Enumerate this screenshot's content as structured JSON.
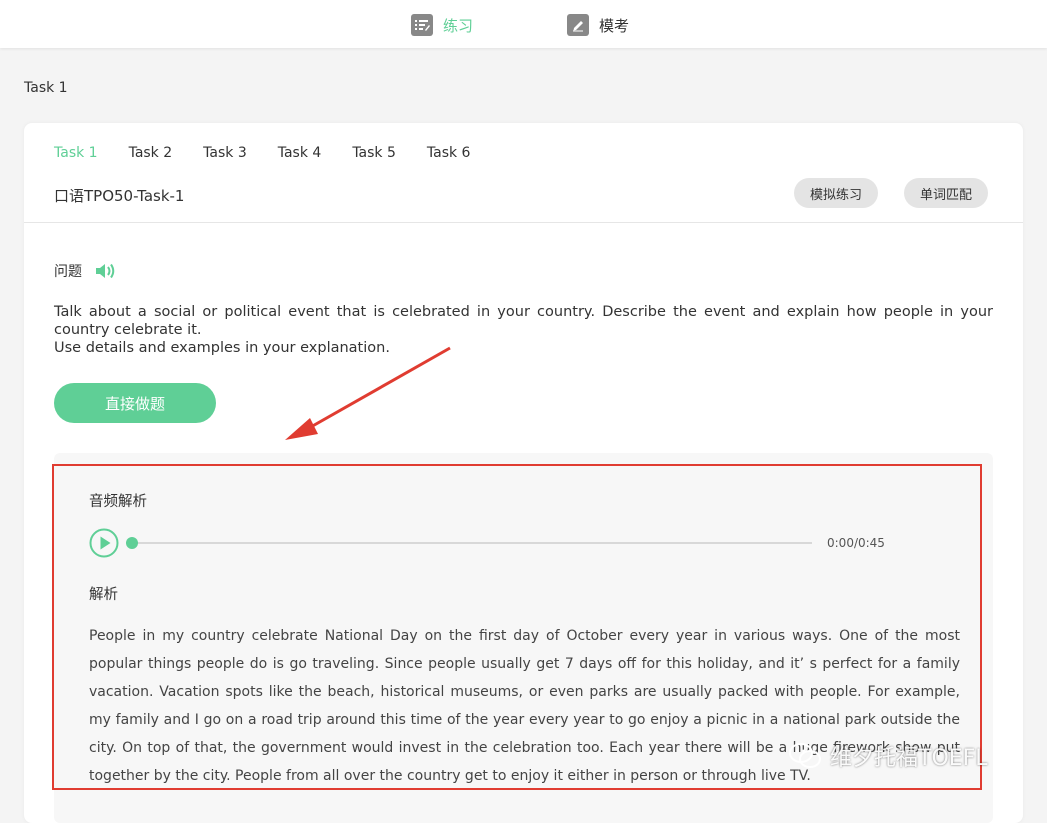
{
  "nav": {
    "practice_label": "练习",
    "exam_label": "模考"
  },
  "breadcrumb": "Task 1",
  "tabs": [
    {
      "label": "Task 1",
      "active": true
    },
    {
      "label": "Task 2"
    },
    {
      "label": "Task 3"
    },
    {
      "label": "Task 4"
    },
    {
      "label": "Task 5"
    },
    {
      "label": "Task 6"
    }
  ],
  "task_title": "口语TPO50-Task-1",
  "buttons": {
    "simulate": "模拟练习",
    "word_match": "单词匹配",
    "start": "直接做题"
  },
  "question": {
    "label": "问题",
    "line1": "Talk about a social or political event that is celebrated in your country. Describe the event and explain how people in your country celebrate it.",
    "line2": "Use details and examples in your explanation."
  },
  "audio": {
    "title": "音频解析",
    "time": "0:00/0:45",
    "progress": 0
  },
  "explanation": {
    "title": "解析",
    "text": "People in my country celebrate National Day on the first day of October every year in various ways. One of the most popular things people do is go traveling. Since people usually get 7 days off for this holiday, and it’ s perfect for a family vacation. Vacation spots like the beach, historical museums, or even parks are usually packed with people. For example, my family and I go on a road trip around this time of the year every year to go enjoy a picnic in a national park outside the city. On top of that, the government would invest in the celebration too. Each year there will be a huge firework show put together by the city. People from all over the country get to enjoy it either in person or through live TV."
  },
  "watermark": "维夕托福TOEFL",
  "colors": {
    "accent": "#5fcf96",
    "highlight_border": "#e03c31"
  },
  "icons": {
    "practice": "list-edit-icon",
    "exam": "pencil-icon",
    "question_audio": "speaker-icon",
    "play": "play-icon",
    "watermark": "wechat-icon"
  }
}
